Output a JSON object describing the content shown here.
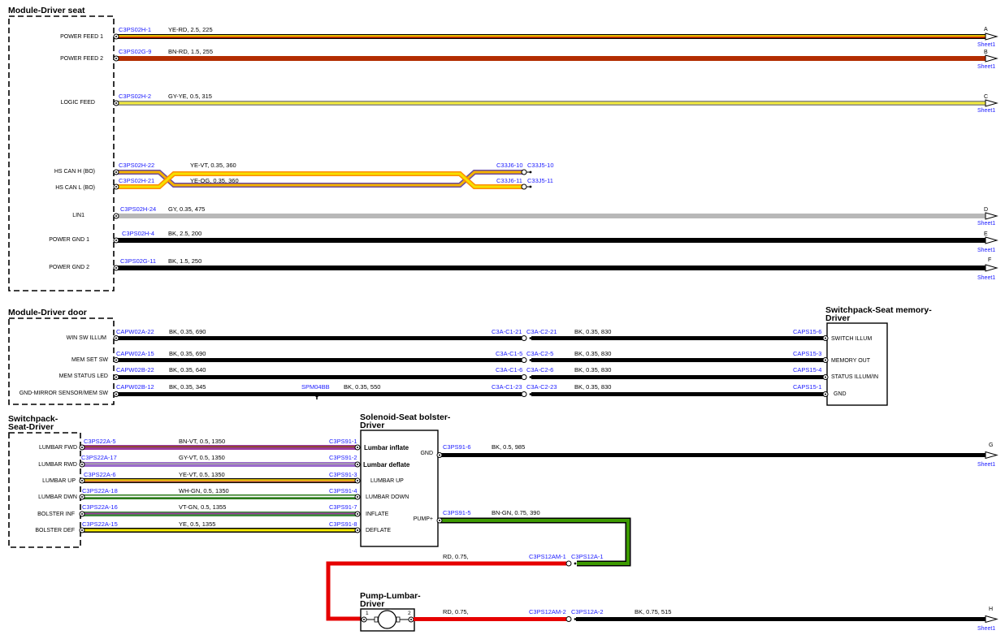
{
  "modules": {
    "driver_seat": {
      "title": "Module-Driver seat",
      "pins": [
        "POWER FEED 1",
        "POWER FEED 2",
        "LOGIC FEED",
        "HS CAN H (BO)",
        "HS CAN L (BO)",
        "LIN1",
        "POWER GND 1",
        "POWER GND 2"
      ]
    },
    "driver_door": {
      "title": "Module-Driver door",
      "pins": [
        "WIN SW ILLUM",
        "MEM SET SW",
        "MEM STATUS LED",
        "GND-MIRROR SENSOR/MEM SW"
      ]
    },
    "switchpack_seat_driver": {
      "title_line1": "Switchpack-",
      "title_line2": "Seat-Driver",
      "pins": [
        "LUMBAR FWD",
        "LUMBAR RWD",
        "LUMBAR UP",
        "LUMBAR DWN",
        "BOLSTER INF",
        "BOLSTER DEF"
      ]
    },
    "switchpack_seat_memory": {
      "title_line1": "Switchpack-Seat memory-",
      "title_line2": "Driver",
      "pins": [
        "SWITCH ILLUM",
        "MEMORY OUT",
        "STATUS ILLUM/IN",
        "GND"
      ]
    },
    "solenoid_bolster": {
      "title_line1": "Solenoid-Seat bolster-",
      "title_line2": "Driver",
      "left_pins": [
        "Lumbar inflate",
        "Lumbar deflate",
        "LUMBAR UP",
        "LUMBAR DOWN",
        "INFLATE",
        "DEFLATE"
      ],
      "right_pins": [
        "GND",
        "PUMP+"
      ]
    },
    "pump_lumbar": {
      "title_line1": "Pump-Lumbar-",
      "title_line2": "Driver",
      "pin1": "1",
      "pin2": "2"
    }
  },
  "seat_wires": [
    {
      "conn": "C3PS02H-1",
      "spec": "YE-RD,  2.5,  225",
      "port": "A",
      "sheet": "Sheet1"
    },
    {
      "conn": "C3PS02G-9",
      "spec": "BN-RD,  1.5,  255",
      "port": "B",
      "sheet": "Sheet1"
    },
    {
      "conn": "C3PS02H-2",
      "spec": "GY-YE,  0.5,  315",
      "port": "C",
      "sheet": "Sheet1"
    },
    {
      "conn": "C3PS02H-22",
      "spec": "YE-VT,  0.35,  360",
      "end_left": "C33J6-10",
      "end_right": "C33J5-10"
    },
    {
      "conn": "C3PS02H-21",
      "spec": "YE-OG,  0.35,  360",
      "end_left": "C33J6-11",
      "end_right": "C33J5-11"
    },
    {
      "conn": "C3PS02H-24",
      "spec": "GY,  0.35,  475",
      "port": "D",
      "sheet": "Sheet1"
    },
    {
      "conn": "C3PS02H-4",
      "spec": "BK,  2.5,  200",
      "port": "E",
      "sheet": "Sheet1"
    },
    {
      "conn": "C3PS02G-11",
      "spec": "BK,  1.5,  250",
      "port": "F",
      "sheet": "Sheet1"
    }
  ],
  "door_wires": [
    {
      "conn": "CAPW02A-22",
      "spec": "BK,  0.35,  690",
      "mid_left": "C3A-C1-21",
      "mid_right": "C3A-C2-21",
      "spec2": "BK,  0.35,  830",
      "end": "CAPS15-6"
    },
    {
      "conn": "CAPW02A-15",
      "spec": "BK,  0.35,  690",
      "mid_left": "C3A-C1-5",
      "mid_right": "C3A-C2-5",
      "spec2": "BK,  0.35,  830",
      "end": "CAPS15-3"
    },
    {
      "conn": "CAPW02B-22",
      "spec": "BK,  0.35,  640",
      "mid_left": "C3A-C1-6",
      "mid_right": "C3A-C2-6",
      "spec2": "BK,  0.35,  830",
      "end": "CAPS15-4"
    },
    {
      "conn": "CAPW02B-12",
      "spec": "BK,  0.35,  345",
      "splice": "SPM04BB",
      "spec_b": "BK,  0.35,  550",
      "mid_left": "C3A-C1-23",
      "mid_right": "C3A-C2-23",
      "spec2": "BK,  0.35,  830",
      "end": "CAPS15-1"
    }
  ],
  "switch_wires": [
    {
      "conn": "C3PS22A-5",
      "spec": "BN-VT,  0.5,  1350",
      "end": "C3PS91-1"
    },
    {
      "conn": "C3PS22A-17",
      "spec": "GY-VT,  0.5,  1350",
      "end": "C3PS91-2"
    },
    {
      "conn": "C3PS22A-6",
      "spec": "YE-VT,  0.5,  1350",
      "end": "C3PS91-3"
    },
    {
      "conn": "C3PS22A-18",
      "spec": "WH-GN,  0.5,  1350",
      "end": "C3PS91-4"
    },
    {
      "conn": "C3PS22A-16",
      "spec": "VT-GN,  0.5,  1355",
      "end": "C3PS91-7"
    },
    {
      "conn": "C3PS22A-15",
      "spec": "YE,  0.5,  1355",
      "end": "C3PS91-8"
    }
  ],
  "solenoid_wires": {
    "gnd": {
      "conn": "C3PS91-6",
      "spec": "BK,  0.5,  985",
      "port": "G",
      "sheet": "Sheet1"
    },
    "pump": {
      "conn": "C3PS91-5",
      "spec": "BN-GN,  0.75,  390"
    },
    "red1": {
      "spec": "RD,  0.75,",
      "left": "C3PS12AM-1",
      "right": "C3PS12A-1"
    },
    "red2": {
      "spec": "RD,  0.75,",
      "left": "C3PS12AM-2",
      "right": "C3PS12A-2",
      "spec2": "BK,  0.75,  515",
      "port": "H",
      "sheet": "Sheet1"
    }
  },
  "colors": {
    "ink": "#000000",
    "connector_blue": "#1a1aff",
    "black_wire": "#000000",
    "red_wire": "#e60000",
    "green_wire": "#3d7a00",
    "gray_wire": "#b8b8b8"
  }
}
